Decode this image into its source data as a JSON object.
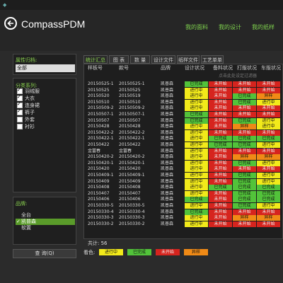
{
  "app": {
    "title": "CompassPDM"
  },
  "nav": {
    "fabric": "我的面料",
    "design": "我的设计",
    "sample": "我的纸样"
  },
  "left": {
    "attr_label": "属性归档:",
    "attr_value": "全部",
    "category_label": "分类系列:",
    "categories": [
      {
        "label": "羽绒服",
        "checked": true
      },
      {
        "label": "大衣",
        "checked": true
      },
      {
        "label": "连身裙",
        "checked": true
      },
      {
        "label": "裤子",
        "checked": true
      },
      {
        "label": "外套",
        "checked": false
      },
      {
        "label": "衬衫",
        "checked": false
      }
    ],
    "brand_label": "品牌:",
    "brands": [
      {
        "label": "全台",
        "checked": false
      },
      {
        "label": "凯普森",
        "checked": true
      },
      {
        "label": "软置",
        "checked": false
      }
    ],
    "query_button": "查 询(Q)"
  },
  "tabs": [
    "统计汇总",
    "图 表",
    "数 量",
    "设计文件",
    "纸样文件",
    "工艺单单"
  ],
  "columns": [
    "样板号",
    "款号",
    "品牌",
    "设计状况",
    "备料状况",
    "打版状况",
    "车版状况"
  ],
  "hint": "点击此处设定过滤器",
  "colors": {
    "进行中": "#f2ea1a",
    "已完成": "#52c33a",
    "未开始": "#d6241e",
    "异样": "#f08a16",
    "": "#cfcfcf"
  },
  "rows": [
    {
      "sample": "20150525-1",
      "style": "20150525-1",
      "brand": "凯普森",
      "s": [
        "已完成",
        "未开始",
        "未开始",
        "未开始"
      ]
    },
    {
      "sample": "20150525",
      "style": "20150525",
      "brand": "凯普森",
      "s": [
        "进行中",
        "未开始",
        "未开始",
        "未开始"
      ]
    },
    {
      "sample": "20150520",
      "style": "20150519",
      "brand": "凯普森",
      "s": [
        "进行中",
        "未开始",
        "已完成",
        "异样"
      ]
    },
    {
      "sample": "20150510",
      "style": "20150510",
      "brand": "凯普森",
      "s": [
        "进行中",
        "未开始",
        "已完成",
        "进行中"
      ]
    },
    {
      "sample": "20150509-2",
      "style": "20150509-2",
      "brand": "凯普森",
      "s": [
        "进行中",
        "未开始",
        "未开始",
        "未开始"
      ]
    },
    {
      "sample": "20150507-1",
      "style": "20150507-1",
      "brand": "凯普森",
      "s": [
        "已完成",
        "未开始",
        "未开始",
        "未开始"
      ]
    },
    {
      "sample": "20150507",
      "style": "20150507",
      "brand": "凯普森",
      "s": [
        "已完成",
        "未开始",
        "已完成",
        "进行中"
      ]
    },
    {
      "sample": "20150428",
      "style": "20150428",
      "brand": "凯普森",
      "s": [
        "进行中",
        "未开始",
        "异样",
        "进行中"
      ]
    },
    {
      "sample": "20150422-2",
      "style": "20150422-2",
      "brand": "凯普森",
      "s": [
        "进行中",
        "未开始",
        "未开始",
        "未开始"
      ]
    },
    {
      "sample": "20150422-1",
      "style": "20150422-1",
      "brand": "凯普森",
      "s": [
        "进行中",
        "已完成",
        "已完成",
        "已完成"
      ]
    },
    {
      "sample": "20150422",
      "style": "20150422",
      "brand": "凯普森",
      "s": [
        "进行中",
        "已完成",
        "已完成",
        "进行中"
      ]
    },
    {
      "sample": "金富春",
      "style": "金富春",
      "brand": "凯普森",
      "s": [
        "进行中",
        "未开始",
        "未开始",
        "未开始"
      ]
    },
    {
      "sample": "20150420-2",
      "style": "20150420-2",
      "brand": "凯普森",
      "s": [
        "进行中",
        "未开始",
        "异样",
        "异样"
      ]
    },
    {
      "sample": "20150420-1",
      "style": "20150420-1",
      "brand": "凯普森",
      "s": [
        "进行中",
        "未开始",
        "已完成",
        "进行中"
      ]
    },
    {
      "sample": "20150420",
      "style": "20150420",
      "brand": "凯普森",
      "s": [
        "进行中",
        "未开始",
        "未开始",
        "未开始"
      ]
    },
    {
      "sample": "20150409-1",
      "style": "20150409-1",
      "brand": "凯普森",
      "s": [
        "进行中",
        "未开始",
        "已完成",
        "进行中"
      ]
    },
    {
      "sample": "20150409",
      "style": "20150409",
      "brand": "凯普森",
      "s": [
        "进行中",
        "未开始",
        "已完成",
        "进行中"
      ]
    },
    {
      "sample": "20150408",
      "style": "20150408",
      "brand": "凯普森",
      "s": [
        "进行中",
        "已完成",
        "已完成",
        "已完成"
      ]
    },
    {
      "sample": "20150407",
      "style": "20150407",
      "brand": "凯普森",
      "s": [
        "进行中",
        "未开始",
        "已完成",
        "已完成"
      ]
    },
    {
      "sample": "20150406",
      "style": "20150406",
      "brand": "凯普森",
      "s": [
        "已完成",
        "未开始",
        "已完成",
        "已完成"
      ]
    },
    {
      "sample": "20150330-5",
      "style": "20150330-5",
      "brand": "凯普森",
      "s": [
        "进行中",
        "未开始",
        "已完成",
        "进行中"
      ]
    },
    {
      "sample": "20150330-4",
      "style": "20150330-4",
      "brand": "凯普森",
      "s": [
        "已完成",
        "未开始",
        "未开始",
        "未开始"
      ]
    },
    {
      "sample": "20150330-3",
      "style": "20150330-3",
      "brand": "凯普森",
      "s": [
        "进行中",
        "未开始",
        "异样",
        "异样"
      ]
    },
    {
      "sample": "20150330-2",
      "style": "20150330-2",
      "brand": "凯普森",
      "s": [
        "进行中",
        "未开始",
        "未开始",
        "未开始"
      ]
    }
  ],
  "total_label": "共计: 56",
  "legend_label": "看色:",
  "legend": [
    "进行中",
    "已完成",
    "未开始",
    "异样"
  ]
}
